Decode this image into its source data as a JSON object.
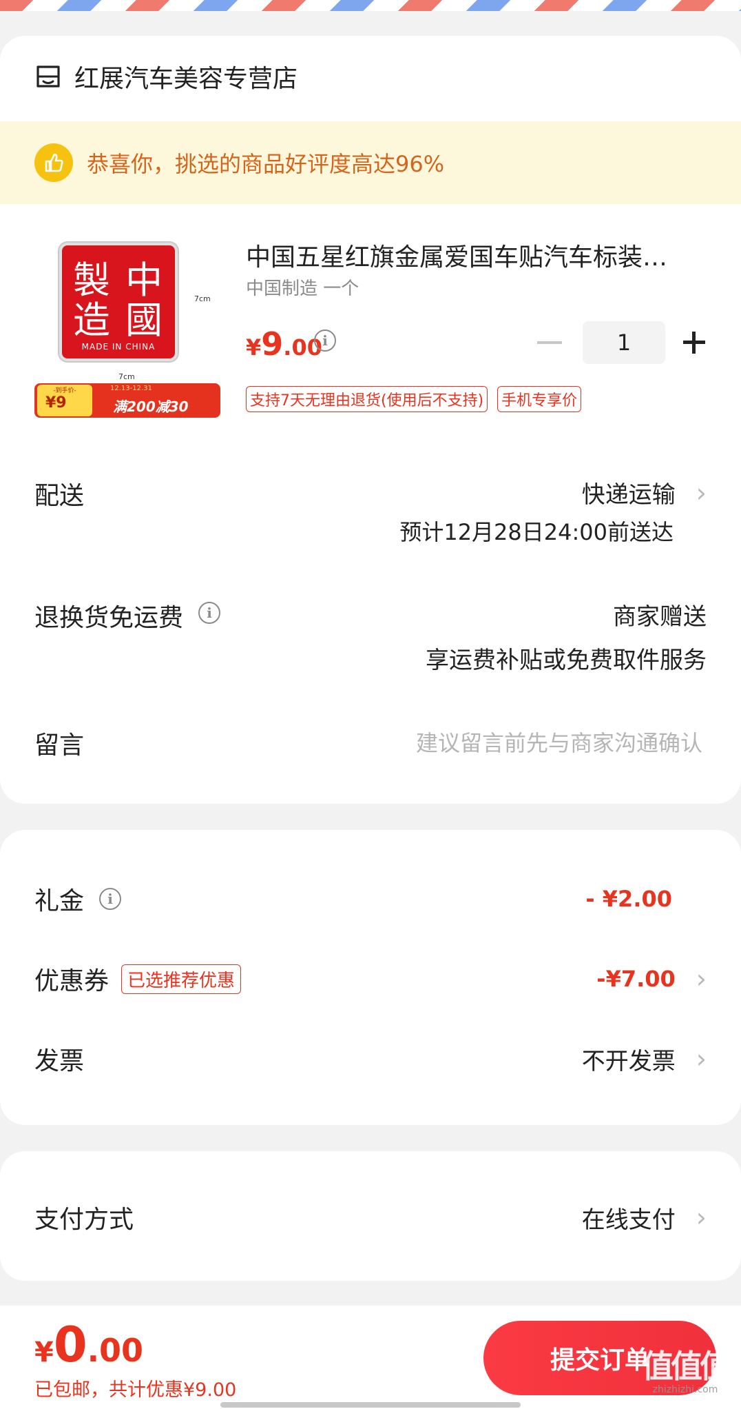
{
  "shop": {
    "name": "红展汽车美容专营店",
    "icon": "shop-icon"
  },
  "banner": {
    "text": "恭喜你，挑选的商品好评度高达96%",
    "icon": "thumbs-up-icon"
  },
  "product": {
    "title": "中国五星红旗金属爱国车贴汽车标装…",
    "spec": "中国制造 一个",
    "price_symbol": "¥",
    "price_int": "9",
    "price_dec": ".00",
    "quantity": "1",
    "tags": [
      "支持7天无理由退货(使用后不支持)",
      "手机专享价"
    ],
    "image": {
      "seal_chars": [
        "製",
        "中",
        "造",
        "國"
      ],
      "made_in": "MADE IN CHINA",
      "dim_h": "7cm",
      "dim_w": "7cm",
      "promo_left_top": "-到手价-",
      "promo_left_price": "¥9",
      "promo_date": "12.13-12.31",
      "promo_right": "满200减30"
    }
  },
  "delivery": {
    "label": "配送",
    "method": "快递运输",
    "eta": "预计12月28日24:00前送达"
  },
  "return": {
    "label": "退换货免运费",
    "value": "商家赠送",
    "sub": "享运费补贴或免费取件服务"
  },
  "message": {
    "label": "留言",
    "placeholder": "建议留言前先与商家沟通确认"
  },
  "discounts": {
    "gift_label": "礼金",
    "gift_value": "- ¥2.00",
    "coupon_label": "优惠券",
    "coupon_tag": "已选推荐优惠",
    "coupon_value": "-¥7.00",
    "invoice_label": "发票",
    "invoice_value": "不开发票"
  },
  "payment": {
    "label": "支付方式",
    "value": "在线支付"
  },
  "bottom": {
    "total_symbol": "¥",
    "total_int": "0",
    "total_dec": ".00",
    "note": "已包邮，共计优惠¥9.00",
    "submit": "提交订单",
    "watermark_main": "值值值",
    "watermark_sub": "zhizhizhi.com"
  },
  "colors": {
    "accent": "#e8341f",
    "banner_bg": "#fdf8dc",
    "banner_text": "#d4651c",
    "icon_yellow": "#f5c30f"
  }
}
